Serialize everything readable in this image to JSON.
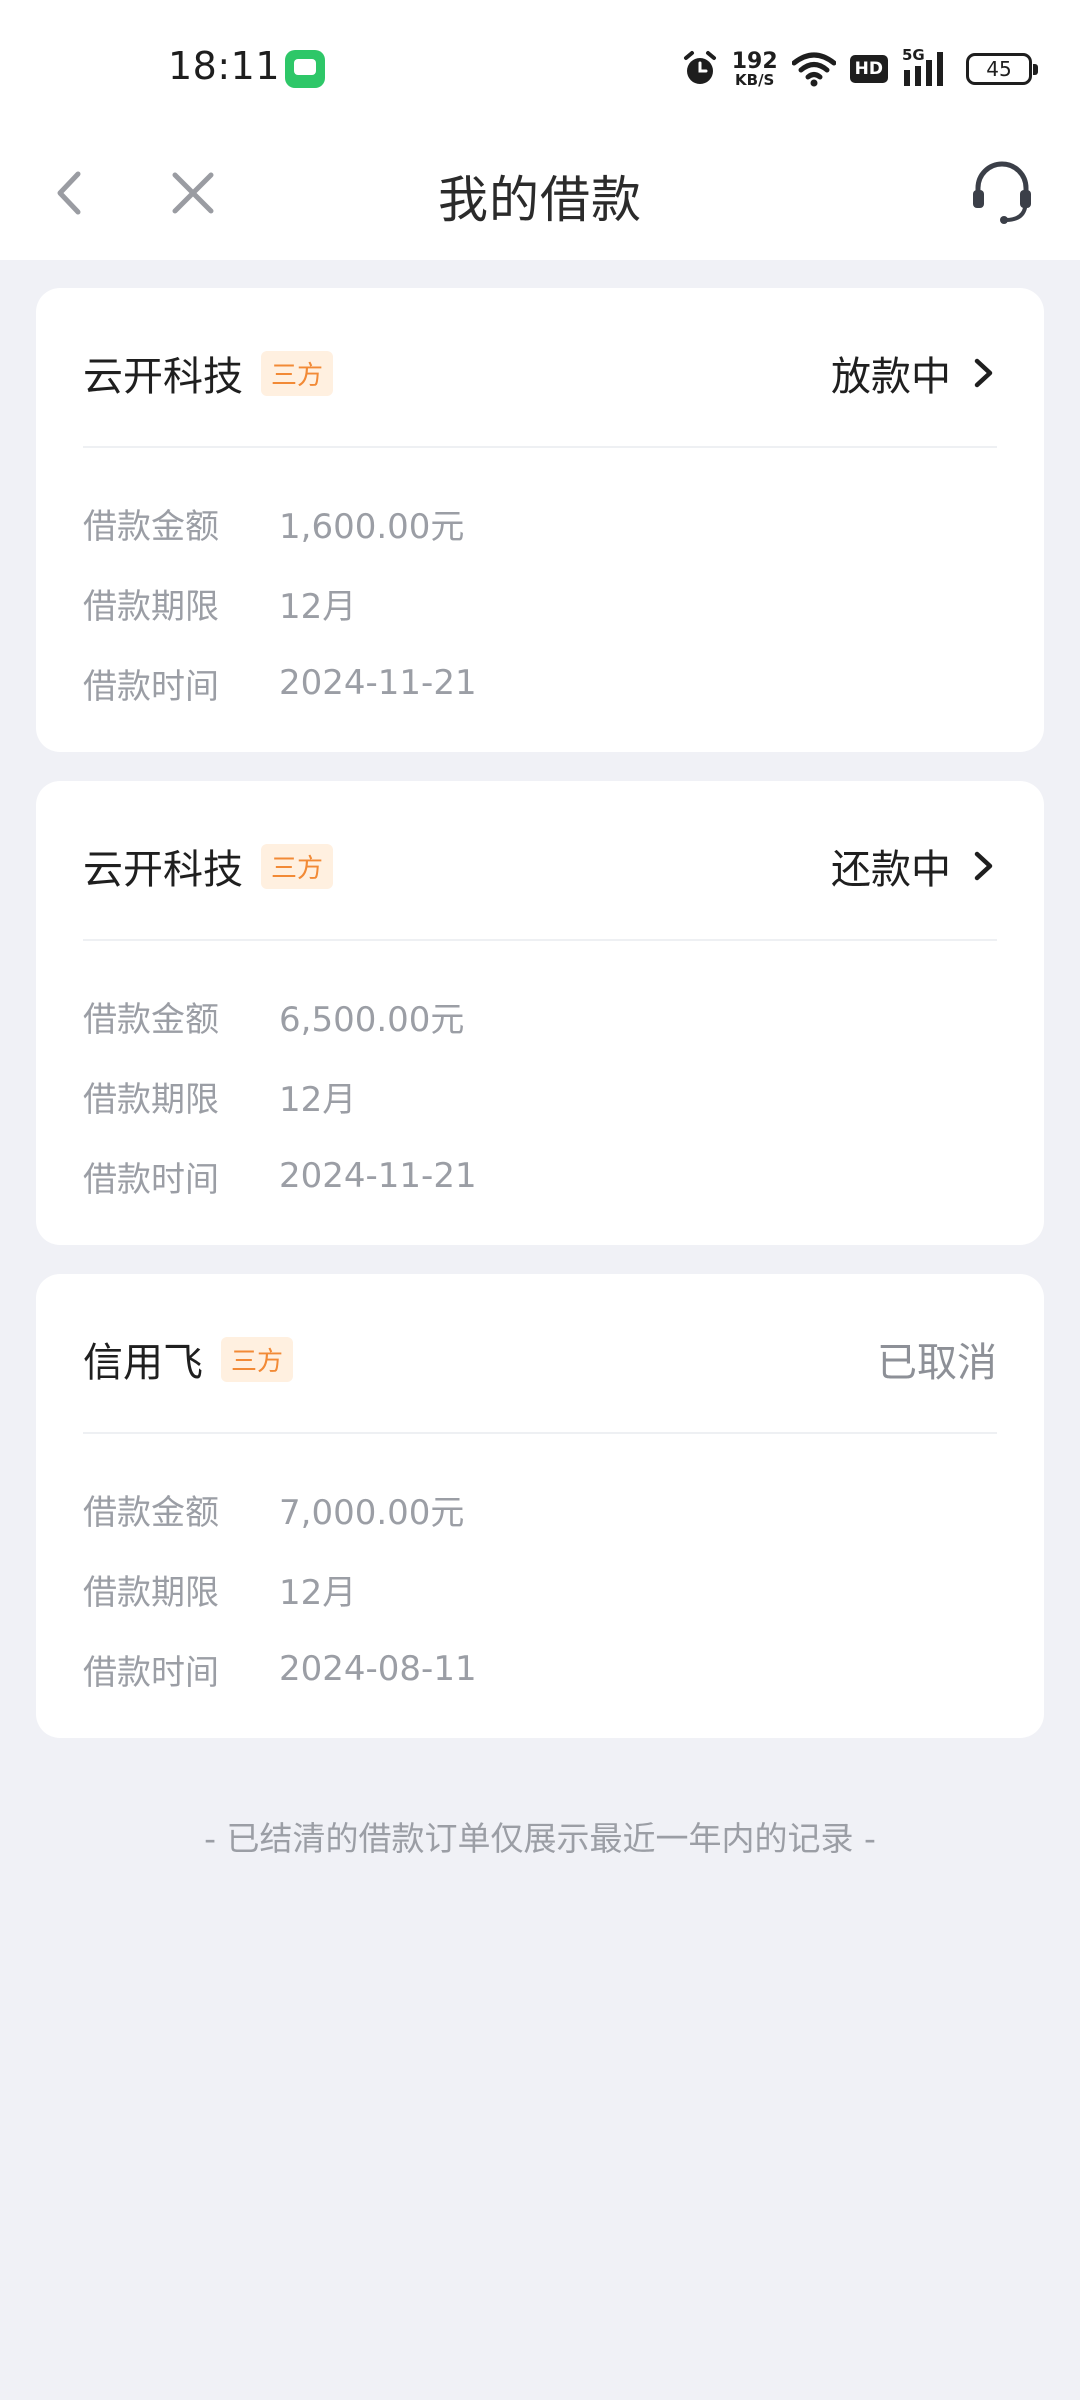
{
  "status_bar": {
    "time": "18:11",
    "net_speed_value": "192",
    "net_speed_unit": "KB/S",
    "hd_label": "HD",
    "network_label": "5G",
    "battery": "45"
  },
  "nav": {
    "title": "我的借款"
  },
  "loans": [
    {
      "lender": "云开科技",
      "tag": "三方",
      "status": "放款中",
      "rows": [
        {
          "label": "借款金额",
          "value": "1,600.00元"
        },
        {
          "label": "借款期限",
          "value": "12月"
        },
        {
          "label": "借款时间",
          "value": "2024-11-21"
        }
      ]
    },
    {
      "lender": "云开科技",
      "tag": "三方",
      "status": "还款中",
      "rows": [
        {
          "label": "借款金额",
          "value": "6,500.00元"
        },
        {
          "label": "借款期限",
          "value": "12月"
        },
        {
          "label": "借款时间",
          "value": "2024-11-21"
        }
      ]
    },
    {
      "lender": "信用飞",
      "tag": "三方",
      "status": "已取消",
      "rows": [
        {
          "label": "借款金额",
          "value": "7,000.00元"
        },
        {
          "label": "借款期限",
          "value": "12月"
        },
        {
          "label": "借款时间",
          "value": "2024-08-11"
        }
      ]
    }
  ],
  "footer_note": "- 已结清的借款订单仅展示最近一年内的记录 -",
  "colors": {
    "background": "#f0f1f6",
    "tag_bg": "#fff0e0",
    "tag_text": "#f28a36",
    "muted_text": "#9b9ea5"
  }
}
